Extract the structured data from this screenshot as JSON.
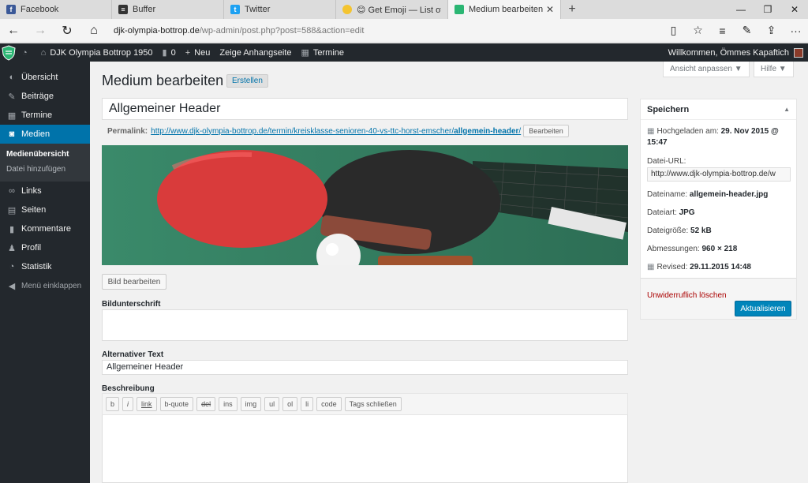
{
  "browser": {
    "tabs": [
      {
        "label": "Facebook",
        "icon": "facebook-icon",
        "color": "#3b5998"
      },
      {
        "label": "Buffer",
        "icon": "buffer-icon",
        "color": "#333333"
      },
      {
        "label": "Twitter",
        "icon": "twitter-icon",
        "color": "#1da1f2"
      },
      {
        "label": "😊 Get Emoji — List of all Er",
        "icon": "emoji-icon",
        "color": "#f4c430"
      },
      {
        "label": "Medium bearbeiten ‹ D.",
        "icon": "wp-shield-icon",
        "color": "#2bb673"
      }
    ],
    "new_tab": "+",
    "url_host": "djk-olympia-bottrop.de",
    "url_path": "/wp-admin/post.php?post=588&action=edit"
  },
  "adminbar": {
    "site_name": "DJK Olympia Bottrop 1950",
    "comments_count": "0",
    "new_label": "Neu",
    "view_label": "Zeige Anhangseite",
    "events_label": "Termine",
    "greeting": "Willkommen, Ömmes Kapaftich"
  },
  "sidebar": {
    "items": [
      {
        "label": "Übersicht",
        "icon": "dashboard-icon"
      },
      {
        "label": "Beiträge",
        "icon": "pin-icon"
      },
      {
        "label": "Termine",
        "icon": "calendar-icon"
      },
      {
        "label": "Medien",
        "icon": "media-icon"
      },
      {
        "label": "Links",
        "icon": "link-icon"
      },
      {
        "label": "Seiten",
        "icon": "page-icon"
      },
      {
        "label": "Kommentare",
        "icon": "comment-icon"
      },
      {
        "label": "Profil",
        "icon": "user-icon"
      },
      {
        "label": "Statistik",
        "icon": "stats-icon"
      }
    ],
    "submenu": [
      "Medienübersicht",
      "Datei hinzufügen"
    ],
    "collapse": "Menü einklappen"
  },
  "main": {
    "title": "Medium bearbeiten",
    "add_new": "Erstellen",
    "screen_options": "Ansicht anpassen ▼",
    "help": "Hilfe ▼",
    "post_title": "Allgemeiner Header",
    "permalink_label": "Permalink:",
    "permalink_base": "http://www.djk-olympia-bottrop.de/termin/kreisklasse-senioren-40-vs-ttc-horst-emscher/",
    "permalink_slug": "allgemein-header",
    "permalink_trail": "/",
    "permalink_edit": "Bearbeiten",
    "edit_image": "Bild bearbeiten",
    "caption_label": "Bildunterschrift",
    "alt_label": "Alternativer Text",
    "alt_value": "Allgemeiner Header",
    "description_label": "Beschreibung",
    "quicktags": [
      "b",
      "i",
      "link",
      "b-quote",
      "del",
      "ins",
      "img",
      "ul",
      "ol",
      "li",
      "code",
      "Tags schließen"
    ]
  },
  "publish": {
    "heading": "Speichern",
    "uploaded_label": "Hochgeladen am:",
    "uploaded_value": "29. Nov 2015 @ 15:47",
    "file_url_label": "Datei-URL:",
    "file_url_value": "http://www.djk-olympia-bottrop.de/w",
    "filename_label": "Dateiname:",
    "filename_value": "allgemein-header.jpg",
    "filetype_label": "Dateiart:",
    "filetype_value": "JPG",
    "filesize_label": "Dateigröße:",
    "filesize_value": "52 kB",
    "dimensions_label": "Abmessungen:",
    "dimensions_value": "960 × 218",
    "revised_label": "Revised:",
    "revised_value": "29.11.2015 14:48",
    "delete_label": "Unwiderruflich löschen",
    "update_label": "Aktualisieren"
  },
  "colors": {
    "admin_dark": "#23282d",
    "primary_blue": "#0073aa",
    "button_blue": "#0085ba",
    "delete_red": "#aa0000"
  }
}
